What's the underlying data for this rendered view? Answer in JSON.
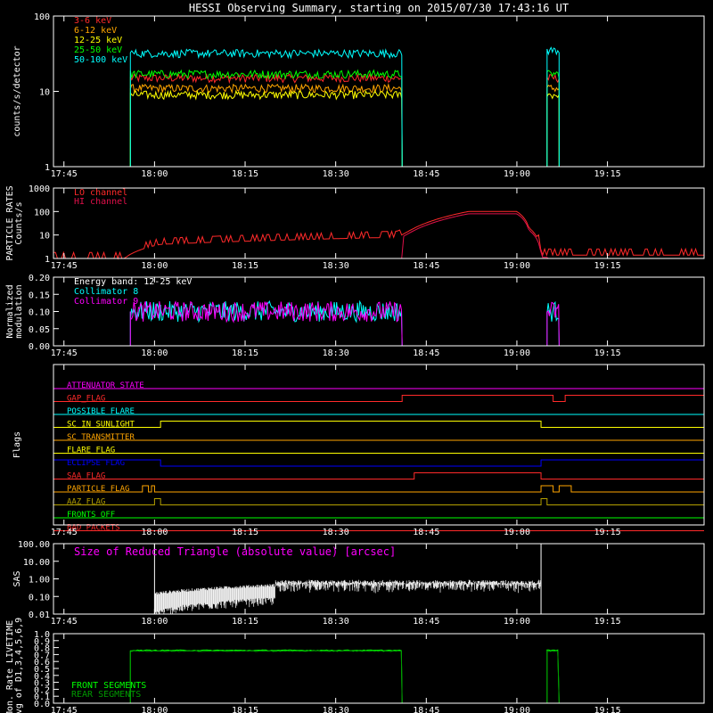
{
  "chart_data": {
    "type": "line",
    "title": "HESSI Observing Summary, starting on 2015/07/30 17:43:16 UT",
    "time_ticks": [
      "17:45",
      "18:00",
      "18:15",
      "18:30",
      "18:45",
      "19:00",
      "19:15"
    ],
    "time_range": [
      "17:43:16",
      "19:31"
    ],
    "colors": {
      "bg": "#000000",
      "axis": "#ffffff",
      "red": "#ff2a2a",
      "orange": "#ffa500",
      "yellow": "#ffff00",
      "green": "#00ff00",
      "cyan": "#00ffff",
      "magenta": "#ff00ff",
      "blue": "#0000ff",
      "olive": "#b4a000",
      "crimson": "#e0104a",
      "darkgreen": "#009900"
    },
    "panels": [
      {
        "id": "count-rates",
        "ylabel": "counts/s/detector",
        "scale": "log",
        "ylim": [
          1,
          100
        ],
        "yticks": [
          "1",
          "10",
          "100"
        ],
        "legend": [
          {
            "label": "3-6 keV",
            "color": "red"
          },
          {
            "label": "6-12 keV",
            "color": "orange"
          },
          {
            "label": "12-25 keV",
            "color": "yellow"
          },
          {
            "label": "25-50 keV",
            "color": "green"
          },
          {
            "label": "50-100 keV",
            "color": "cyan"
          }
        ],
        "series": [
          {
            "name": "3-6 keV",
            "color": "red",
            "segments": [
              {
                "start": "17:56",
                "end": "18:41",
                "level": 15
              },
              {
                "start": "19:05",
                "end": "19:07",
                "level": 15
              }
            ]
          },
          {
            "name": "6-12 keV",
            "color": "orange",
            "segments": [
              {
                "start": "17:56",
                "end": "18:41",
                "level": 11
              },
              {
                "start": "19:05",
                "end": "19:07",
                "level": 11
              }
            ]
          },
          {
            "name": "12-25 keV",
            "color": "yellow",
            "segments": [
              {
                "start": "17:56",
                "end": "18:41",
                "level": 9
              },
              {
                "start": "19:05",
                "end": "19:07",
                "level": 9
              }
            ]
          },
          {
            "name": "25-50 keV",
            "color": "green",
            "segments": [
              {
                "start": "17:56",
                "end": "18:41",
                "level": 17
              },
              {
                "start": "19:05",
                "end": "19:07",
                "level": 17
              }
            ]
          },
          {
            "name": "50-100 keV",
            "color": "cyan",
            "segments": [
              {
                "start": "17:56",
                "end": "18:41",
                "level": 32
              },
              {
                "start": "19:05",
                "end": "19:07",
                "level": 35
              }
            ]
          }
        ]
      },
      {
        "id": "particle-rates",
        "ylabel": [
          "PARTICLE RATES",
          "Counts/s"
        ],
        "scale": "log",
        "ylim": [
          1,
          1000
        ],
        "yticks": [
          "1",
          "10",
          "100",
          "1000"
        ],
        "legend": [
          {
            "label": "LO channel",
            "color": "red"
          },
          {
            "label": "HI channel",
            "color": "crimson"
          }
        ]
      },
      {
        "id": "modulation",
        "ylabel": [
          "Normalized",
          "modulation"
        ],
        "scale": "linear",
        "ylim": [
          0,
          0.2
        ],
        "yticks": [
          "0.00",
          "0.05",
          "0.10",
          "0.15",
          "0.20"
        ],
        "legend": [
          {
            "label": "Energy band: 12-25 keV",
            "color": "axis"
          },
          {
            "label": "Collimator 8",
            "color": "cyan"
          },
          {
            "label": "Collimator 9",
            "color": "magenta"
          }
        ]
      },
      {
        "id": "flags",
        "ylabel": "Flags",
        "flags": [
          {
            "label": "ATTENUATOR STATE",
            "color": "magenta",
            "on": []
          },
          {
            "label": "GAP_FLAG",
            "color": "red",
            "on": [
              [
                "18:41",
                "19:06"
              ],
              [
                "19:08",
                "19:31"
              ]
            ]
          },
          {
            "label": "POSSIBLE FLARE",
            "color": "cyan",
            "on": []
          },
          {
            "label": "SC IN SUNLIGHT",
            "color": "yellow",
            "on": [
              [
                "18:01",
                "19:04"
              ]
            ]
          },
          {
            "label": "SC TRANSMITTER",
            "color": "orange",
            "on": []
          },
          {
            "label": "FLARE FLAG",
            "color": "yellow",
            "on": []
          },
          {
            "label": "ECLIPSE FLAG",
            "color": "blue",
            "on": [
              [
                "17:43:16",
                "18:01"
              ],
              [
                "19:04",
                "19:31"
              ]
            ]
          },
          {
            "label": "SAA FLAG",
            "color": "red",
            "on": [
              [
                "18:43",
                "19:04"
              ]
            ]
          },
          {
            "label": "PARTICLE FLAG",
            "color": "orange",
            "on": [
              [
                "17:58",
                "17:59"
              ],
              [
                "17:59:30",
                "18:00"
              ],
              [
                "19:04",
                "19:06"
              ],
              [
                "19:07",
                "19:09"
              ]
            ]
          },
          {
            "label": "AAZ FLAG",
            "color": "olive",
            "on": [
              [
                "18:00",
                "18:01"
              ],
              [
                "19:04",
                "19:05"
              ]
            ]
          },
          {
            "label": "FRONTS OFF",
            "color": "green",
            "on": []
          },
          {
            "label": "BAD PACKETS",
            "color": "red",
            "on": []
          }
        ]
      },
      {
        "id": "sas",
        "ylabel": "SAS",
        "scale": "log",
        "ylim": [
          0.01,
          100
        ],
        "yticks": [
          "0.01",
          "0.10",
          "1.00",
          "10.00",
          "100.00"
        ],
        "annotation": "Size of Reduced Triangle (absolute value) [arcsec]",
        "annotation_color": "magenta"
      },
      {
        "id": "livetime",
        "ylabel": [
          "Mon. Rate LIVETIME",
          "avg of D1,3,4,5,6,9"
        ],
        "scale": "linear",
        "ylim": [
          0,
          1
        ],
        "yticks": [
          "0.0",
          "0.1",
          "0.2",
          "0.3",
          "0.4",
          "0.5",
          "0.6",
          "0.7",
          "0.8",
          "0.9",
          "1.0"
        ],
        "legend": [
          {
            "label": "FRONT SEGMENTS",
            "color": "green"
          },
          {
            "label": "REAR SEGMENTS",
            "color": "darkgreen"
          }
        ],
        "series": [
          {
            "name": "FRONT SEGMENTS",
            "color": "green",
            "segments": [
              {
                "start": "17:56",
                "end": "18:41",
                "level": 0.76
              },
              {
                "start": "19:05",
                "end": "19:07",
                "level": 0.76
              }
            ]
          },
          {
            "name": "REAR SEGMENTS",
            "color": "darkgreen",
            "segments": [
              {
                "start": "17:56",
                "end": "18:41",
                "level": 0.75
              },
              {
                "start": "19:05",
                "end": "19:07",
                "level": 0.75
              }
            ]
          }
        ]
      }
    ]
  }
}
